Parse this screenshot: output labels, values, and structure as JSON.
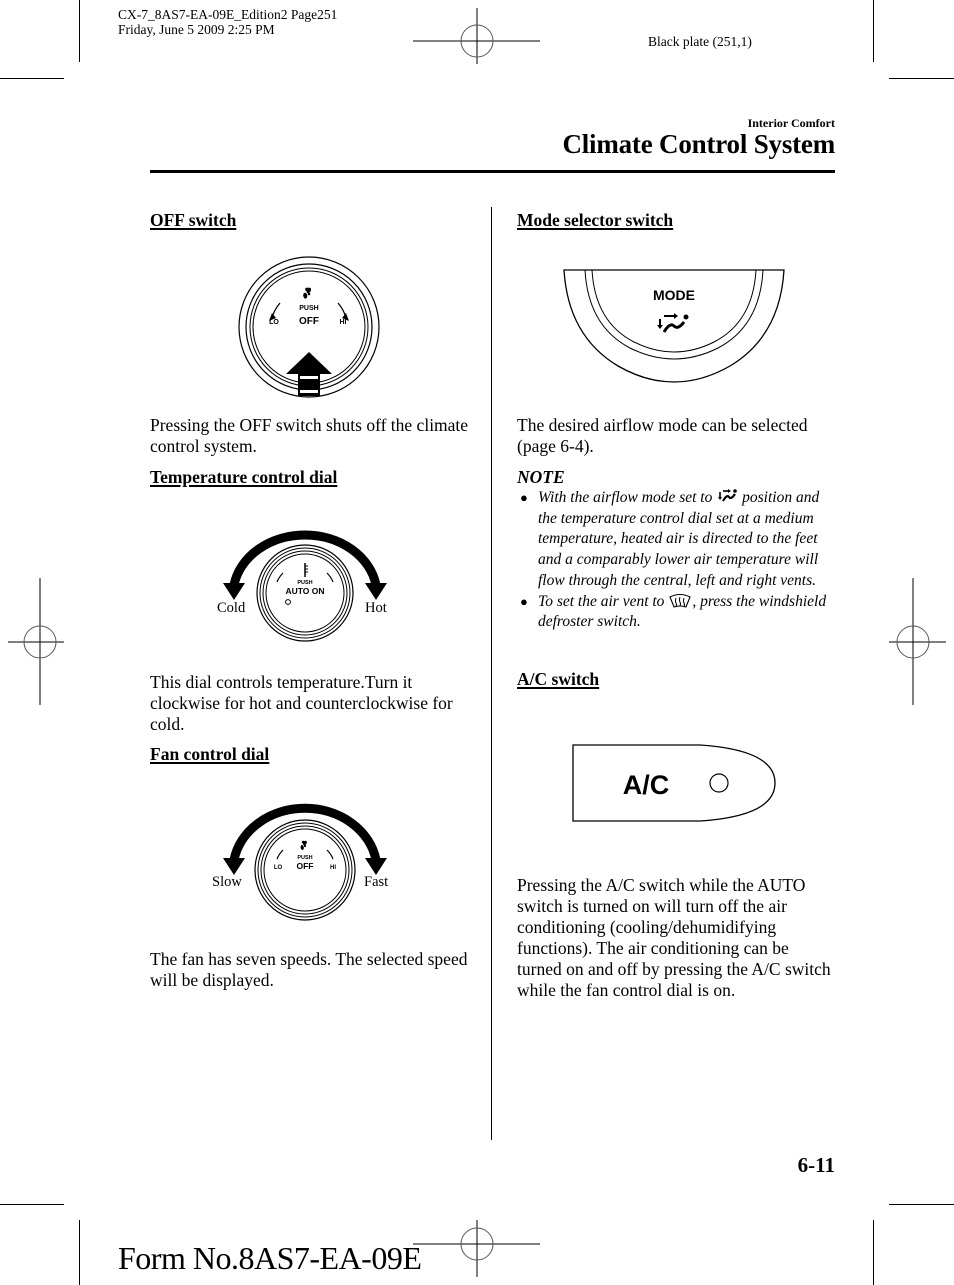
{
  "print_slug": {
    "line1": "CX-7_8AS7-EA-09E_Edition2 Page251",
    "line2": "Friday, June 5 2009 2:25 PM",
    "plate": "Black plate (251,1)"
  },
  "header": {
    "section": "Interior Comfort",
    "title": "Climate Control System"
  },
  "left_column": {
    "off_switch": {
      "heading": "OFF switch",
      "figure": {
        "top_icon": "fan-icon",
        "push": "PUSH",
        "center": "OFF",
        "left": "LO",
        "right": "HI"
      },
      "text": "Pressing the OFF switch shuts off the climate control system."
    },
    "temperature_dial": {
      "heading": "Temperature control dial",
      "figure": {
        "top_icon": "thermometer-icon",
        "push": "PUSH",
        "center": "AUTO ON",
        "left_label": "Cold",
        "right_label": "Hot"
      },
      "text": "This dial controls temperature.Turn it clockwise for hot and counterclockwise for cold."
    },
    "fan_dial": {
      "heading": "Fan control dial",
      "figure": {
        "top_icon": "fan-icon",
        "push": "PUSH",
        "center": "OFF",
        "left": "LO",
        "right": "HI",
        "left_label": "Slow",
        "right_label": "Fast"
      },
      "text": "The fan has seven speeds. The selected speed will be displayed."
    }
  },
  "right_column": {
    "mode_switch": {
      "heading": "Mode selector switch",
      "figure": {
        "label": "MODE",
        "icon": "airflow-mode-icon"
      },
      "text": "The desired airflow mode can be selected (page 6-4)."
    },
    "note": {
      "title": "NOTE",
      "items": [
        {
          "before": "With the airflow mode set to",
          "icon": "airflow-mode-icon",
          "after": " position and the temperature control dial set at a medium temperature, heated air is directed to the feet and a comparably lower air temperature will flow through the central, left and right vents."
        },
        {
          "before": "To set the air vent to",
          "icon": "windshield-defroster-icon",
          "after": ", press the windshield defroster switch."
        }
      ]
    },
    "ac_switch": {
      "heading": "A/C switch",
      "figure": {
        "label": "A/C",
        "indicator": "indicator-light"
      },
      "text": "Pressing the A/C switch while the AUTO switch is turned on will turn off the air conditioning (cooling/dehumidifying functions). The air conditioning can be turned on and off by pressing the A/C switch while the fan control dial is on."
    }
  },
  "footer": {
    "page_number": "6-11",
    "form_number": "Form No.8AS7-EA-09E"
  }
}
